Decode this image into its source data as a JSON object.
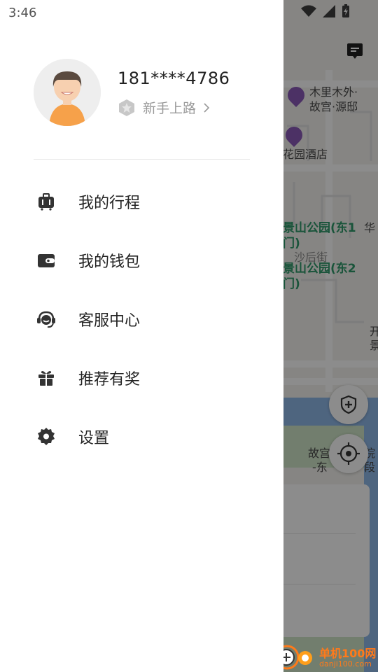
{
  "status_bar": {
    "time": "3:46"
  },
  "user": {
    "phone": "181****4786",
    "level": "新手上路"
  },
  "menu": [
    {
      "label": "我的行程",
      "icon": "suitcase-icon"
    },
    {
      "label": "我的钱包",
      "icon": "wallet-icon"
    },
    {
      "label": "客服中心",
      "icon": "headset-icon"
    },
    {
      "label": "推荐有奖",
      "icon": "gift-icon"
    },
    {
      "label": "设置",
      "icon": "gear-icon"
    }
  ],
  "map": {
    "poi_1_line1": "木里木外·",
    "poi_1_line2": "故宫·源邸",
    "poi_2": "花园酒店",
    "park_1_line1": "景山公园(东1",
    "park_1_line2": "门)",
    "park_1_suffix": "华",
    "park_2_line1": "景山公园(东2",
    "park_2_line2": "门)",
    "street": "沙后街",
    "kai_1": "开",
    "kai_2": "景",
    "poi_3_line1": "故宫",
    "poi_3_suffix": "院",
    "poi_3_line2": "-东",
    "poi_3_suffix2": "段",
    "poi_pin_color": "#8b5ab8",
    "park_color": "#2f9a6a"
  },
  "watermark": {
    "line1": "单机100网",
    "line2": "danji100.com"
  }
}
